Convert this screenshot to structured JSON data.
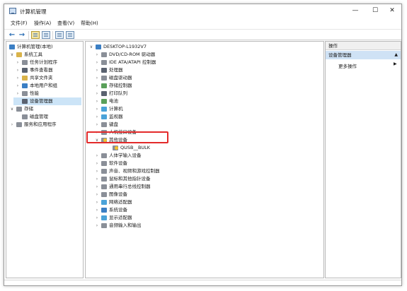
{
  "window": {
    "title": "计算机管理",
    "minimize": "—",
    "maximize": "☐",
    "close": "✕"
  },
  "menubar": [
    "文件(F)",
    "操作(A)",
    "查看(V)",
    "帮助(H)"
  ],
  "left_tree": {
    "root": "计算机管理(本地)",
    "system_tools": "系统工具",
    "items": [
      "任务计划程序",
      "事件查看器",
      "共享文件夹",
      "本地用户和组",
      "性能",
      "设备管理器"
    ],
    "storage": "存储",
    "disk_mgmt": "磁盘管理",
    "services": "服务和应用程序"
  },
  "device_tree": {
    "computer": "DESKTOP-L1932V7",
    "categories": [
      "DVD/CD-ROM 驱动器",
      "IDE ATA/ATAPI 控制器",
      "处理器",
      "磁盘驱动器",
      "存储控制器",
      "打印队列",
      "电池",
      "计算机",
      "监视器",
      "键盘",
      "人机接口设备",
      "其他设备",
      "QUSB__BULK",
      "人体学输入设备",
      "软件设备",
      "声音、视频和游戏控制器",
      "鼠标和其他指针设备",
      "通用串行总线控制器",
      "图像设备",
      "网络适配器",
      "系统设备",
      "显示适配器",
      "音频输入和输出"
    ]
  },
  "actions": {
    "header": "操作",
    "section": "设备管理器",
    "more": "更多操作"
  }
}
